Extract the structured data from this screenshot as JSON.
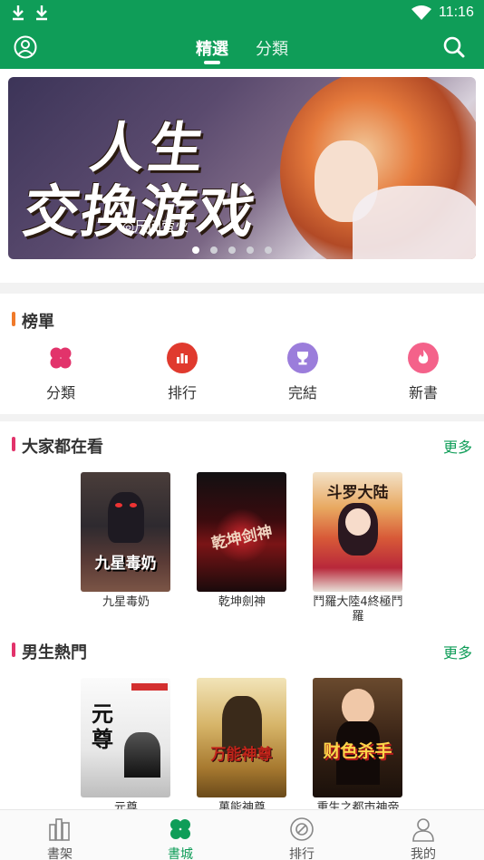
{
  "status": {
    "time": "11:16"
  },
  "header": {
    "tabs": [
      {
        "label": "精選"
      },
      {
        "label": "分類"
      }
    ]
  },
  "banner": {
    "title_line1": "人生",
    "title_line2": "交換游戏",
    "author": "◎尺间萤火",
    "page_count": 5,
    "active_page": 1
  },
  "ranking": {
    "title": "榜單",
    "items": [
      {
        "label": "分類",
        "icon": "clover-icon",
        "color": "#e2336b"
      },
      {
        "label": "排行",
        "icon": "bar-chart-icon",
        "color": "#e03a2e"
      },
      {
        "label": "完結",
        "icon": "trophy-icon",
        "color": "#9b7ddb"
      },
      {
        "label": "新書",
        "icon": "flame-icon",
        "color": "#f4628a"
      }
    ]
  },
  "popular": {
    "title": "大家都在看",
    "more": "更多",
    "books": [
      {
        "name": "九星毒奶",
        "cover_text": "九星毒奶"
      },
      {
        "name": "乾坤劍神",
        "cover_text": "乾坤剑神"
      },
      {
        "name": "鬥羅大陸4終極鬥羅",
        "cover_text": "斗罗大陆"
      }
    ]
  },
  "male_hot": {
    "title": "男生熱門",
    "more": "更多",
    "books": [
      {
        "name": "元尊",
        "cover_text": "元尊"
      },
      {
        "name": "萬能神尊",
        "cover_text": "万能神尊"
      },
      {
        "name": "重生之都市神帝",
        "cover_text": "财色杀手"
      }
    ]
  },
  "bottom_nav": {
    "items": [
      {
        "label": "書架",
        "icon": "bookshelf-icon"
      },
      {
        "label": "書城",
        "icon": "clover-icon"
      },
      {
        "label": "排行",
        "icon": "ranking-icon"
      },
      {
        "label": "我的",
        "icon": "profile-icon"
      }
    ]
  },
  "colors": {
    "brand": "#0f9d58",
    "section_bar_orange": "#f07a2a",
    "section_bar_pink": "#e2336b"
  }
}
